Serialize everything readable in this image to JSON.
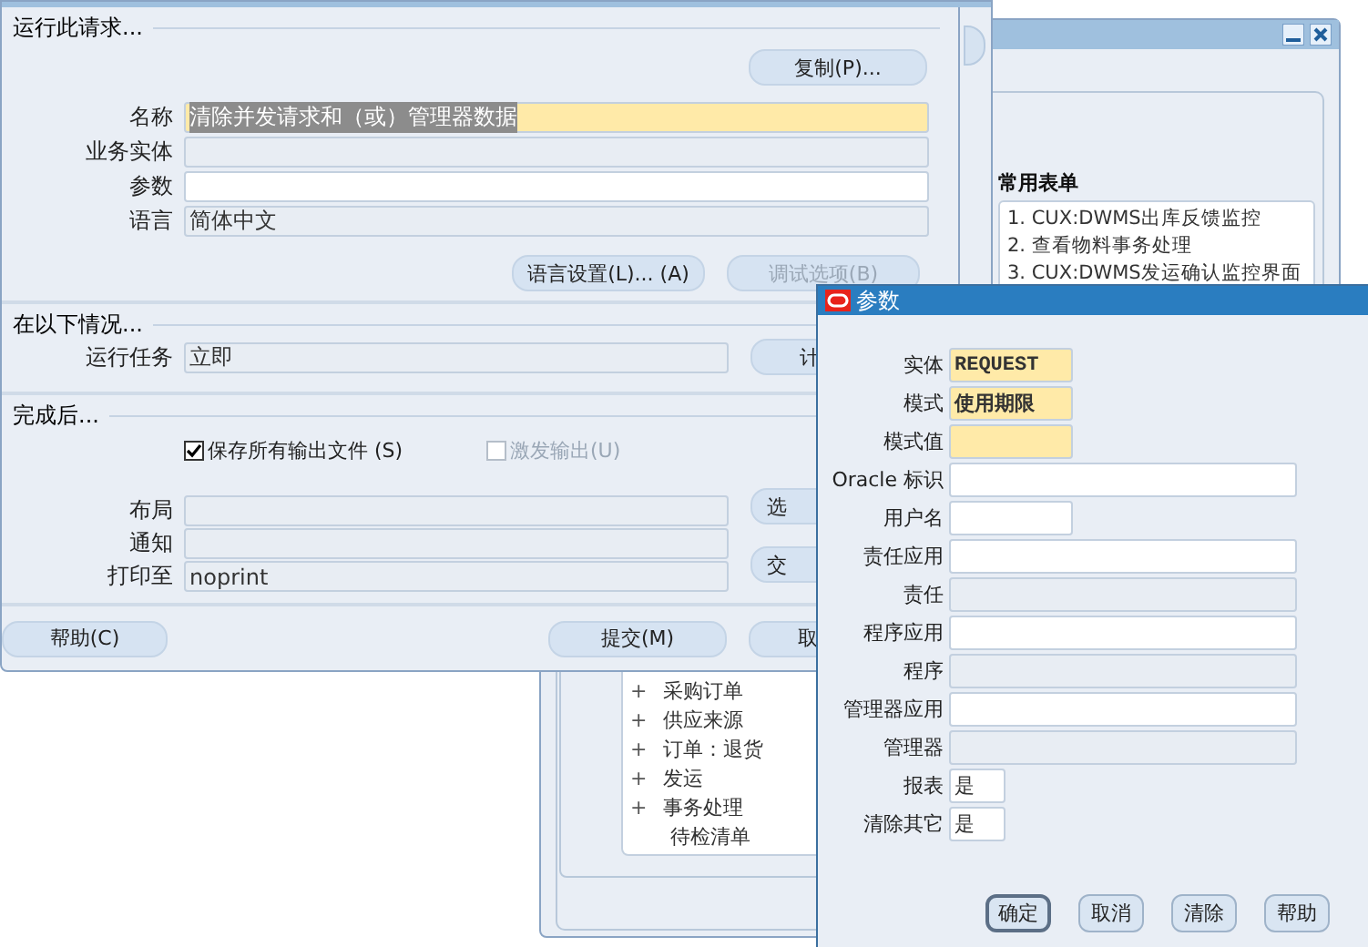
{
  "submit_request": {
    "run_section": {
      "heading": "运行此请求...",
      "copy_button": "复制(P)...",
      "fields": [
        {
          "label": "名称",
          "value": "清除并发请求和（或）管理器数据",
          "kind": "required",
          "highlighted": true
        },
        {
          "label": "业务实体",
          "kind": "readonly"
        },
        {
          "label": "参数",
          "kind": "editable"
        },
        {
          "label": "语言",
          "value": "简体中文",
          "kind": "readonly"
        }
      ],
      "buttons": [
        {
          "label": "语言设置(L)... (A)",
          "disabled": false
        },
        {
          "label": "调试选项(B)",
          "disabled": true
        }
      ]
    },
    "schedule_section": {
      "heading": "在以下情况...",
      "fields": [
        {
          "label": "运行任务",
          "value": "立即",
          "kind": "readonly"
        }
      ],
      "button": "计"
    },
    "completion_section": {
      "heading": "完成后...",
      "checkboxes": [
        {
          "label": "保存所有输出文件 (S)",
          "checked": true,
          "disabled": false
        },
        {
          "label": "激发输出(U)",
          "checked": false,
          "disabled": true
        }
      ],
      "fields": [
        {
          "label": "布局",
          "kind": "readonly"
        },
        {
          "label": "通知",
          "kind": "readonly"
        },
        {
          "label": "打印至",
          "value": "noprint",
          "kind": "readonly"
        }
      ],
      "buttons": [
        "选",
        "交"
      ]
    },
    "footer_buttons": [
      "帮助(C)",
      "提交(M)",
      "取"
    ]
  },
  "navigator": {
    "favorites_heading": "常用表单",
    "favorites": [
      "1. CUX:DWMS出库反馈监控",
      "2. 查看物料事务处理",
      "3. CUX:DWMS发运确认监控界面"
    ],
    "tree": [
      {
        "label": "采购订单",
        "expander": "+"
      },
      {
        "label": "供应来源",
        "expander": "+"
      },
      {
        "label": "订单：退货",
        "expander": "+"
      },
      {
        "label": "发运",
        "expander": "+"
      },
      {
        "label": "事务处理",
        "expander": "+"
      },
      {
        "label": "待检清单"
      }
    ]
  },
  "parameters_dialog": {
    "title": "参数",
    "fields": [
      {
        "label": "实体",
        "value": "REQUEST",
        "kind": "required"
      },
      {
        "label": "模式",
        "value": "使用期限",
        "kind": "required"
      },
      {
        "label": "模式值",
        "kind": "required"
      },
      {
        "label": "Oracle 标识",
        "kind": "editable"
      },
      {
        "label": "用户名",
        "kind": "editable"
      },
      {
        "label": "责任应用",
        "kind": "editable"
      },
      {
        "label": "责任",
        "kind": "readonly"
      },
      {
        "label": "程序应用",
        "kind": "editable"
      },
      {
        "label": "程序",
        "kind": "readonly"
      },
      {
        "label": "管理器应用",
        "kind": "editable"
      },
      {
        "label": "管理器",
        "kind": "readonly"
      },
      {
        "label": "报表",
        "value": "是",
        "kind": "editable"
      },
      {
        "label": "清除其它",
        "value": "是",
        "kind": "editable"
      }
    ],
    "buttons": [
      {
        "label": "确定",
        "focused": true
      },
      {
        "label": "取消",
        "focused": false
      },
      {
        "label": "清除",
        "focused": false
      },
      {
        "label": "帮助",
        "focused": false
      }
    ]
  }
}
